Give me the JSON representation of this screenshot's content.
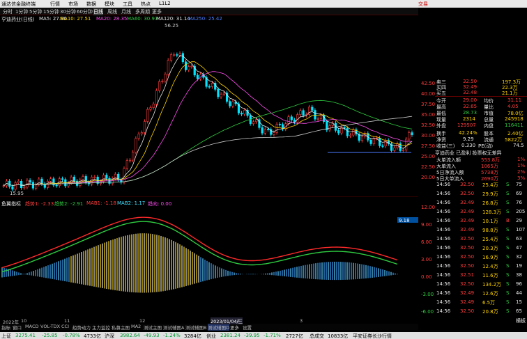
{
  "menubar": {
    "app_title": "通达信金融终端",
    "items": [
      "行情",
      "市场",
      "数据",
      "模块",
      "工具",
      "热点",
      "L1L2"
    ],
    "brand": "交易"
  },
  "periods": [
    "分时",
    "1分钟",
    "5分钟",
    "15分钟",
    "30分钟",
    "60分钟",
    "日线",
    "周线",
    "月线",
    "多周期",
    "更多"
  ],
  "title": {
    "stock": "亨迪药业(日线)",
    "ma5": "MA5: 27.90",
    "ma10": "MA10: 27.51",
    "ma20": "MA20: 28.35",
    "ma60": "MA60: 30.97",
    "ma120": "MA120: 31.14",
    "ma250": "MA250: 25.42"
  },
  "main_chart": {
    "high_label": "56.25",
    "low_label": "15.95",
    "y_ticks": [
      "42.50",
      "40.00",
      "37.50",
      "35.00",
      "32.50",
      "30.00",
      "27.50",
      "25.00",
      "22.50",
      "20.00"
    ]
  },
  "indicator": {
    "name": "鱼翼指标",
    "items": [
      "趋势1: -2.33",
      "趋势2: -2.91",
      "MAB1: -1.18",
      "MAB2: 1.17",
      "趋向: 0.00"
    ],
    "y_ticks": [
      "12.00",
      "9.00",
      "6.00",
      "3.00",
      "0.00",
      "-3.00",
      "-6.00"
    ],
    "marker": "9.18"
  },
  "bottom_tabs": [
    "指标",
    "窗口",
    "MACD",
    "VOL-TDX",
    "CCI",
    "趋势动力",
    "主力监控",
    "私募主图",
    "MA2",
    "测试主图",
    "测试辅图A",
    "测试辅图B",
    "测试辅图D",
    "更多",
    "设置"
  ],
  "date_labels": [
    "2022年",
    "10",
    "11",
    "12",
    "2023/01/04/三",
    "2",
    "3"
  ],
  "quote": {
    "asks": [
      {
        "label": "卖三",
        "price": "32.50",
        "vol": "197.3万"
      },
      {
        "label": "买四",
        "price": "32.49",
        "vol": "22.3万"
      },
      {
        "label": "买五",
        "price": "32.48",
        "vol": "21.1万"
      }
    ],
    "stats": [
      {
        "l1": "今开",
        "v1": "29.00",
        "l2": "均价",
        "v2": "31.11"
      },
      {
        "l1": "最高",
        "v1": "32.65",
        "l2": "量比",
        "v2": "4.05"
      },
      {
        "l1": "最低",
        "v1": "28.73",
        "l2": "市值",
        "v2": "78.0亿"
      },
      {
        "l1": "现量",
        "v1": "2314",
        "l2": "总量",
        "v2": "245918"
      },
      {
        "l1": "外盘",
        "v1": "129507",
        "l2": "内盘",
        "v2": "116411"
      },
      {
        "l1": "换手",
        "v1": "42.24%",
        "l2": "股本",
        "v2": "2.40亿"
      },
      {
        "l1": "净资",
        "v1": "9.29",
        "l2": "流通",
        "v2": "5822万"
      },
      {
        "l1": "收益(三)",
        "v1": "0.330",
        "l2": "PE(动)",
        "v2": "74.5"
      }
    ],
    "company_line": "亨迪药业 已盈利 投票权无差异",
    "flows": [
      {
        "label": "大单流入额",
        "value": "553.8万",
        "pct": "1%"
      },
      {
        "label": "大单流入",
        "value": "1065万",
        "pct": "1%"
      },
      {
        "label": "5日净流入额",
        "value": "5738万",
        "pct": "2%"
      },
      {
        "label": "5日大单流入",
        "value": "2690万",
        "pct": "3%"
      }
    ],
    "ticks": [
      {
        "time": "14:56",
        "price": "32.50",
        "vol": "25.4万",
        "side": "S",
        "n": "75"
      },
      {
        "time": "14:56",
        "price": "32.50",
        "vol": "29.9万",
        "side": "S",
        "n": "69"
      },
      {
        "time": "14:56",
        "price": "32.49",
        "vol": "26.8万",
        "side": "S",
        "n": "76"
      },
      {
        "time": "14:56",
        "price": "32.49",
        "vol": "128.3万",
        "side": "S",
        "n": "205"
      },
      {
        "time": "14:56",
        "price": "32.49",
        "vol": "10.1万",
        "side": "B",
        "n": "29"
      },
      {
        "time": "14:56",
        "price": "32.49",
        "vol": "98.8万",
        "side": "S",
        "n": "107"
      },
      {
        "time": "14:56",
        "price": "32.50",
        "vol": "25.4万",
        "side": "S",
        "n": "63"
      },
      {
        "time": "14:56",
        "price": "32.50",
        "vol": "20.3万",
        "side": "S",
        "n": "47"
      },
      {
        "time": "14:56",
        "price": "32.50",
        "vol": "16.9万",
        "side": "S",
        "n": "32"
      },
      {
        "time": "14:56",
        "price": "32.50",
        "vol": "12.4万",
        "side": "S",
        "n": "19"
      },
      {
        "time": "14:56",
        "price": "32.51",
        "vol": "11.6万",
        "side": "S",
        "n": "38"
      },
      {
        "time": "14:56",
        "price": "32.50",
        "vol": "134.2万",
        "side": "S",
        "n": "96"
      },
      {
        "time": "14:56",
        "price": "32.49",
        "vol": "12.6万",
        "side": "S",
        "n": "44"
      },
      {
        "time": "14:56",
        "price": "32.49",
        "vol": "6.5万",
        "side": "S",
        "n": "15"
      },
      {
        "time": "14:56",
        "price": "32.50",
        "vol": "20.8万",
        "side": "S",
        "n": "65"
      }
    ],
    "tab": "横板"
  },
  "func_bar": [
    "扩展",
    "关联报价",
    "资金分布",
    "综合资讯",
    "行业资讯",
    "互动问答",
    "新闻/产品利专章"
  ],
  "status": [
    {
      "name": "上证",
      "value": "3275.41",
      "chg": "-25.85",
      "pct": "-0.78%",
      "amt": "4733亿"
    },
    {
      "name": "沪深",
      "value": "3982.64",
      "chg": "-49.93",
      "pct": "-1.24%",
      "amt": "3284亿"
    },
    {
      "name": "创业",
      "value": "2381.24",
      "chg": "-39.95",
      "pct": "-1.71%",
      "amt": "2727亿"
    },
    {
      "name": "总成交",
      "value": "10833亿",
      "chg": "",
      "pct": "",
      "amt": "平安证券长沙行情"
    }
  ],
  "colors": {
    "up": "#ff3b3b",
    "down": "#00e5ff",
    "ma5": "#e6e6e6",
    "ma10": "#ffd400",
    "ma20": "#ff4df0",
    "ma60": "#2ecc40",
    "ma120": "#cccccc",
    "ma250": "#4d7dff"
  }
}
